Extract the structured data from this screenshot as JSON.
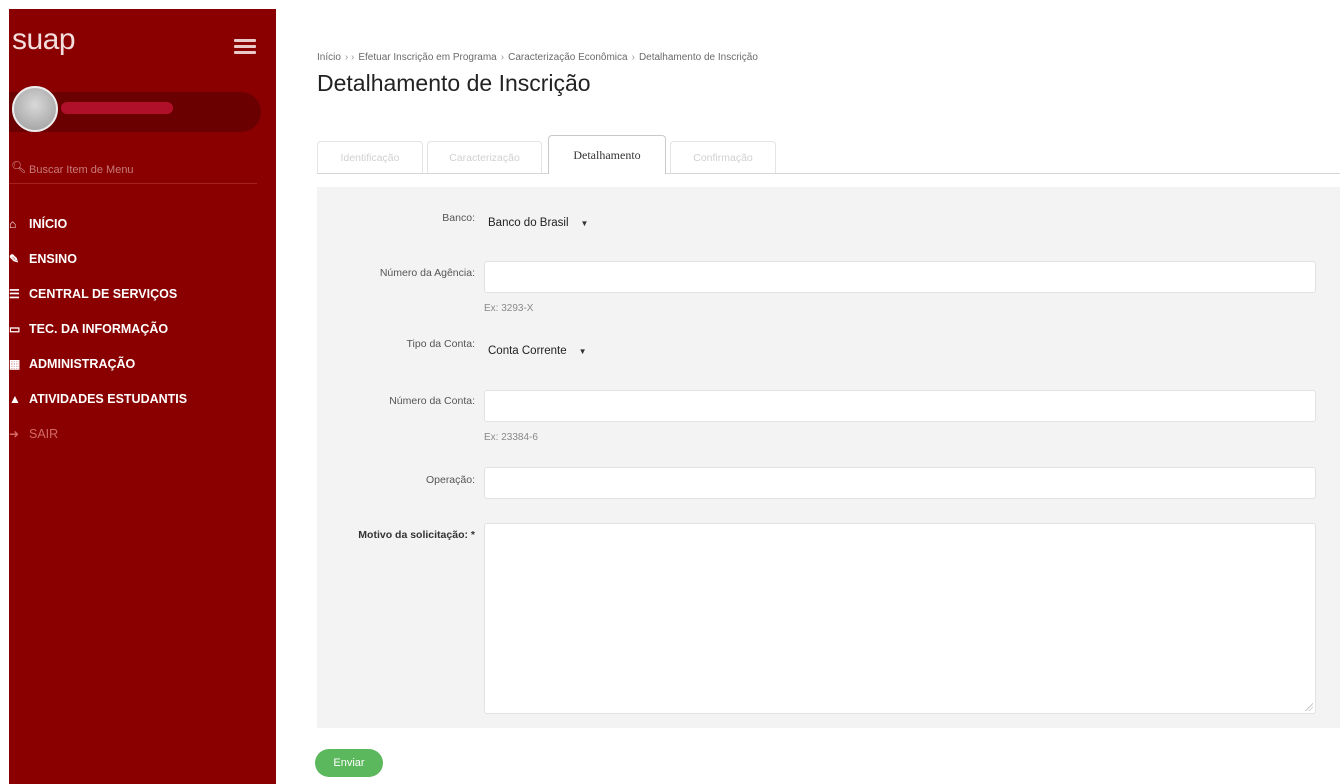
{
  "sidebar": {
    "brand": "suap",
    "search_placeholder": "Buscar Item de Menu",
    "items": [
      {
        "label": "INÍCIO"
      },
      {
        "label": "ENSINO"
      },
      {
        "label": "CENTRAL DE SERVIÇOS"
      },
      {
        "label": "TEC. DA INFORMAÇÃO"
      },
      {
        "label": "ADMINISTRAÇÃO"
      },
      {
        "label": "ATIVIDADES ESTUDANTIS"
      },
      {
        "label": "SAIR"
      }
    ]
  },
  "breadcrumb": [
    "Início",
    "Efetuar Inscrição em Programa",
    "Caracterização Econômica",
    "Detalhamento de Inscrição"
  ],
  "page_title": "Detalhamento de Inscrição",
  "tabs": [
    "Identificação",
    "Caracterização",
    "Detalhamento",
    "Confirmação"
  ],
  "form": {
    "banco_label": "Banco:",
    "banco_value": "Banco do Brasil",
    "agencia_label": "Número da Agência:",
    "agencia_help": "Ex: 3293-X",
    "tipo_label": "Tipo da Conta:",
    "tipo_value": "Conta Corrente",
    "conta_label": "Número da Conta:",
    "conta_help": "Ex: 23384-6",
    "operacao_label": "Operação:",
    "motivo_label": "Motivo da solicitação: *"
  },
  "submit_label": "Enviar"
}
